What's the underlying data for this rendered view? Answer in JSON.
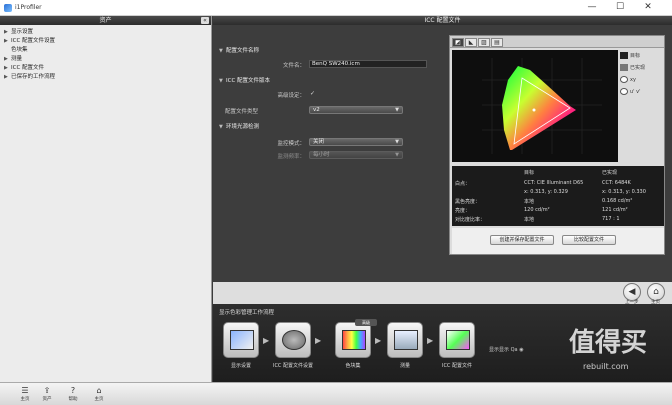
{
  "window": {
    "title": "i1Profiler",
    "min_glyph": "—",
    "max_glyph": "☐",
    "close_glyph": "✕"
  },
  "left_panel": {
    "header": "资产",
    "collapse_glyph": "«",
    "tree": [
      {
        "label": "显示设置",
        "expanded": false,
        "sub": false
      },
      {
        "label": "ICC 配置文件设置",
        "expanded": false,
        "sub": false
      },
      {
        "label": "色块集",
        "expanded": false,
        "sub": true
      },
      {
        "label": "测量",
        "expanded": false,
        "sub": false
      },
      {
        "label": "ICC 配置文件",
        "expanded": false,
        "sub": false
      },
      {
        "label": "已保存的工作流程",
        "expanded": false,
        "sub": false
      }
    ]
  },
  "top_strip": {
    "title": "ICC 配置文件"
  },
  "settings": {
    "profile_name": {
      "title": "配置文件名称",
      "filename_label": "文件名：",
      "filename_value": "BenQ SW240.icm"
    },
    "version": {
      "title": "ICC 配置文件版本",
      "advanced_label": "高级设定：",
      "advanced_checked": true,
      "type_label": "配置文件类型",
      "type_value": "v2"
    },
    "ambient": {
      "title": "环境光源检测",
      "mode_label": "监控模式：",
      "mode_value": "关闭",
      "interval_label": "监测频率：",
      "interval_value": "每小时"
    }
  },
  "graph": {
    "tabs": [
      "◩",
      "◣",
      "▨",
      "▤"
    ],
    "options": [
      {
        "label": "目标",
        "color": "#222222"
      },
      {
        "label": "已实现",
        "color": "#777777"
      },
      {
        "label": "xy",
        "color": "#ffffff"
      },
      {
        "label": "u' v'",
        "color": "#ffffff"
      }
    ],
    "table": {
      "col_target": "目标",
      "col_achieved": "已实现",
      "rows": [
        {
          "label": "白点：",
          "target": "CCT: CIE Illuminant D65",
          "achieved": "CCT: 6484K"
        },
        {
          "label": "",
          "target": "x: 0.313, y: 0.329",
          "achieved": "x: 0.313, y: 0.330"
        },
        {
          "label": "黑色亮度：",
          "target": "本地",
          "achieved": "0.168 cd/m²"
        },
        {
          "label": "亮度：",
          "target": "120 cd/m²",
          "achieved": "121 cd/m²"
        },
        {
          "label": "对比度比率：",
          "target": "本地",
          "achieved": "717 : 1"
        }
      ]
    },
    "btn_create": "创建并保存配置文件",
    "btn_compare": "比较配置文件"
  },
  "nav": {
    "prev_label": "上一步",
    "home_label": "主页"
  },
  "workflow": {
    "title": "显示色彩管理工作流程",
    "steps": [
      "显示设置",
      "ICC 配置文件设置",
      "色块集",
      "测量",
      "ICC 配置文件"
    ],
    "badge": "高级",
    "option_label": "显示显示 Qa",
    "watermark": "值得买",
    "watermark_url": "rebuilt.com"
  },
  "bottombar": [
    {
      "icon": "☰",
      "label": "主页"
    },
    {
      "icon": "⇪",
      "label": "资产"
    },
    {
      "icon": "?",
      "label": "帮助"
    },
    {
      "icon": "⌂",
      "label": "主页"
    }
  ]
}
